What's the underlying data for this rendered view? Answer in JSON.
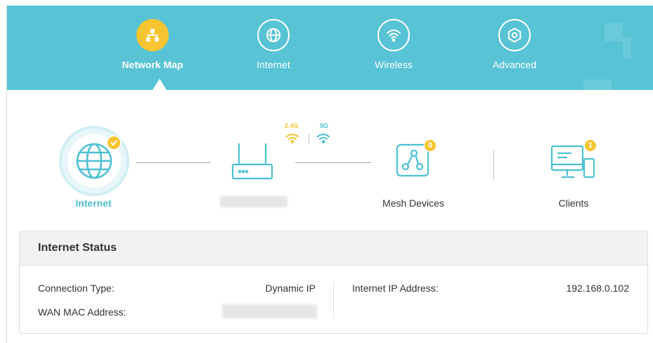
{
  "nav": {
    "items": [
      {
        "label": "Network Map",
        "icon": "network-map-icon",
        "active": true
      },
      {
        "label": "Internet",
        "icon": "globe-icon",
        "active": false
      },
      {
        "label": "Wireless",
        "icon": "wifi-icon",
        "active": false
      },
      {
        "label": "Advanced",
        "icon": "gear-icon",
        "active": false
      }
    ],
    "colors": {
      "header_bg": "#57c3d5",
      "active_bg": "#f7c531"
    }
  },
  "topology": {
    "internet_label": "Internet",
    "router_label": "",
    "band_24": "2.4G",
    "band_5": "5G",
    "mesh_label": "Mesh Devices",
    "mesh_count": "0",
    "clients_label": "Clients",
    "clients_count": "1"
  },
  "status": {
    "title": "Internet Status",
    "connection_type_label": "Connection Type:",
    "connection_type_value": "Dynamic IP",
    "wan_mac_label": "WAN MAC Address:",
    "wan_mac_value": "",
    "ip_label": "Internet IP Address:",
    "ip_value": "192.168.0.102"
  }
}
